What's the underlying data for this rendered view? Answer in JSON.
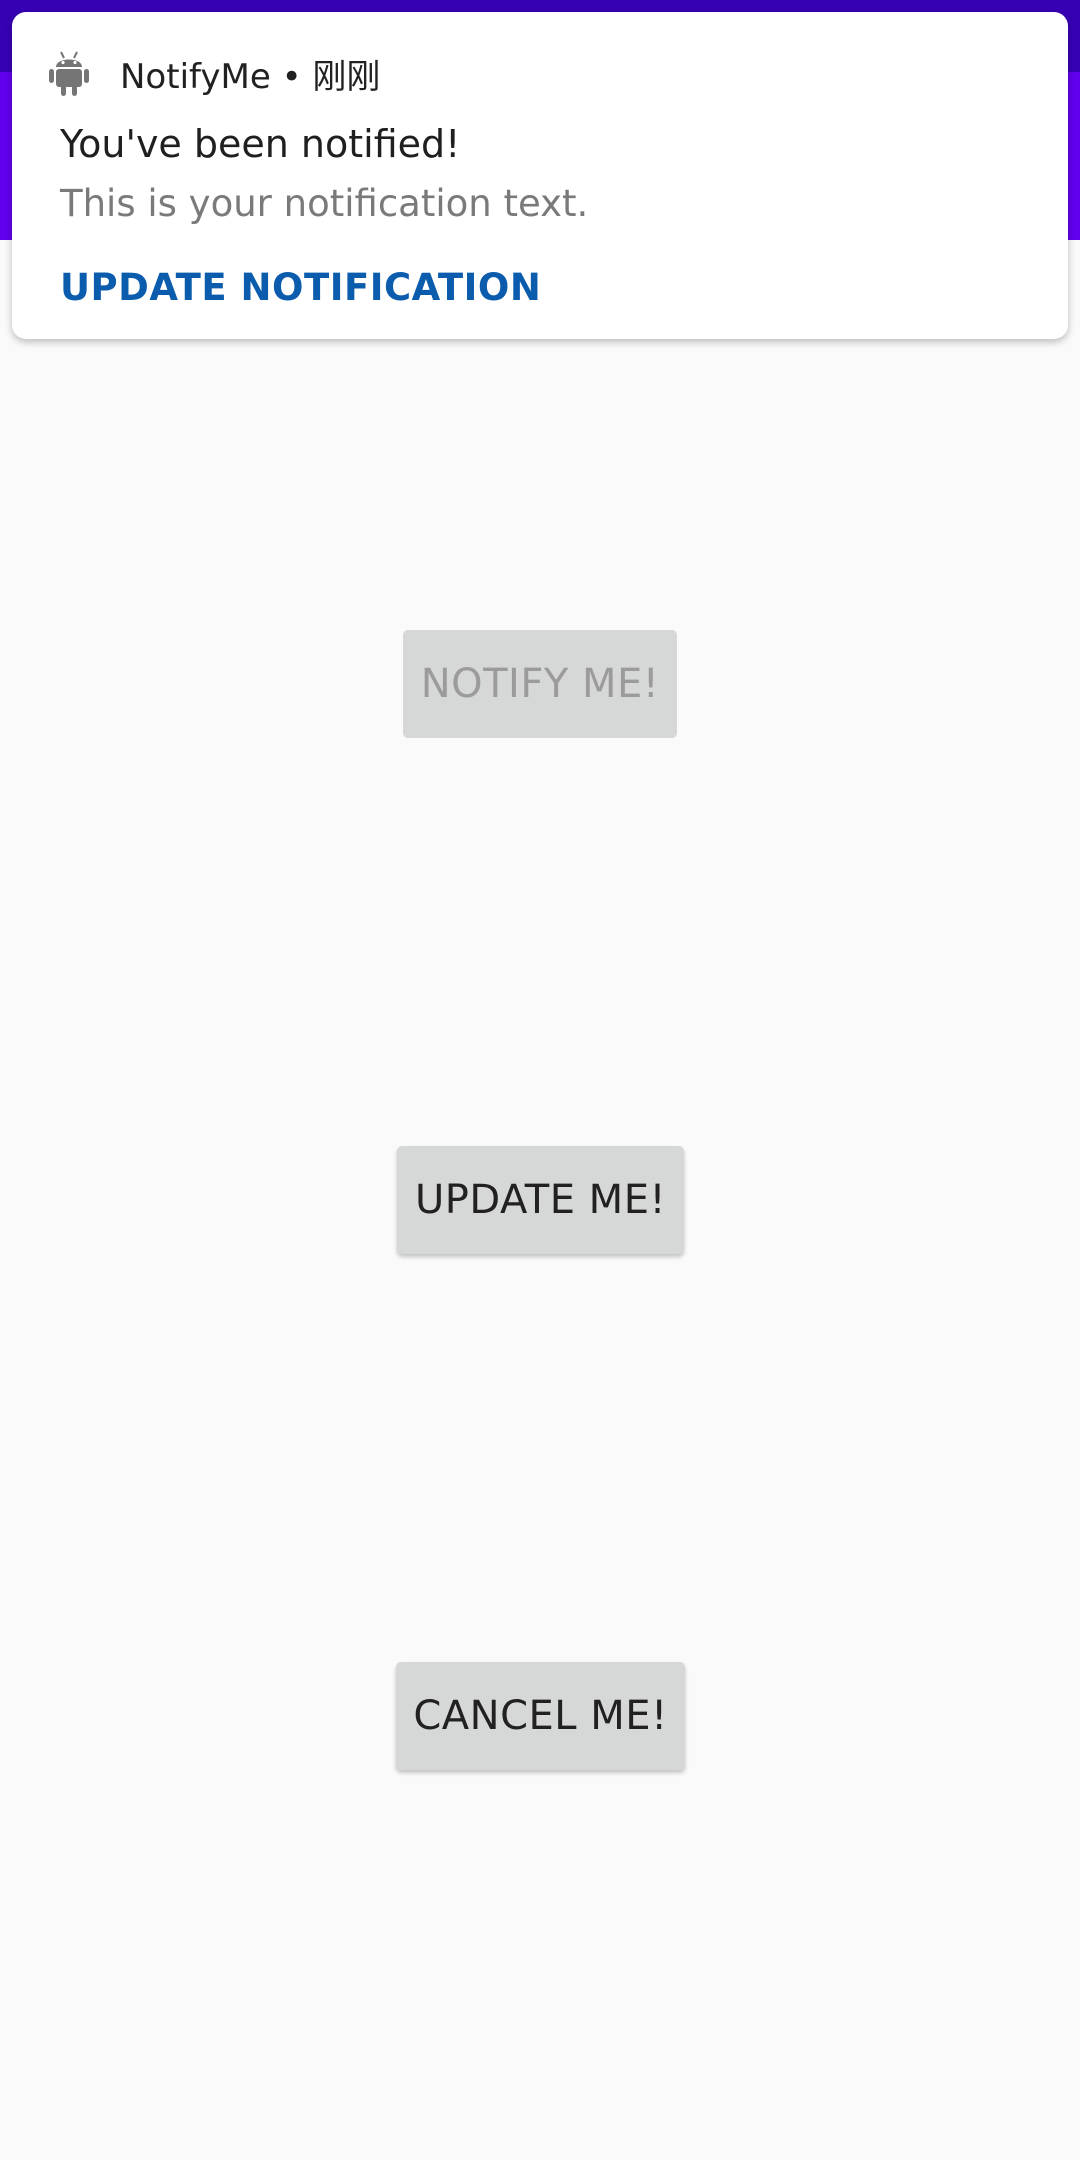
{
  "notification": {
    "icon": "android-robot-icon",
    "app_line": "NotifyMe • 刚刚",
    "title": "You've been notified!",
    "text": "This is your notification text.",
    "action_label": "UPDATE NOTIFICATION"
  },
  "buttons": {
    "notify_label": "NOTIFY ME!",
    "update_label": "UPDATE ME!",
    "cancel_label": "CANCEL ME!"
  },
  "colors": {
    "status_bar": "#3700b3",
    "app_bar": "#6200ee",
    "action": "#0b5cad",
    "button_bg": "#d6d7d7",
    "background": "#fafafa"
  }
}
